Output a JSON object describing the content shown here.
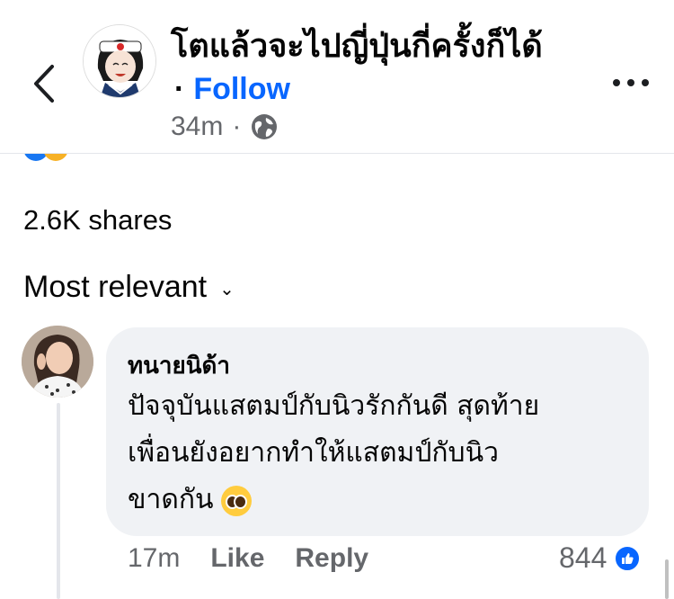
{
  "header": {
    "page_name": "โตแล้วจะไปญี่ปุ่นกี่ครั้งก็ได้",
    "follow_separator": "·",
    "follow_label": "Follow",
    "post_time": "34m",
    "meta_separator": "·",
    "privacy_icon": "globe-icon",
    "back_icon": "chevron-left-icon",
    "more_icon": "more-horizontal-icon"
  },
  "stats": {
    "shares": "2.6K shares"
  },
  "sort": {
    "label": "Most relevant",
    "chevron": "⌄"
  },
  "comment": {
    "author": "ทนายนิด้า",
    "text_lines": [
      "ปัจจุบันแสตมป์กับนิวรักกันดี สุดท้าย",
      "เพื่อนยังอยากทำให้แสตมป์กับนิว",
      "ขาดกัน"
    ],
    "emoji": "pleading-face-emoji",
    "time": "17m",
    "like_label": "Like",
    "reply_label": "Reply",
    "like_count": "844"
  },
  "colors": {
    "accent": "#0866ff",
    "secondary_text": "#65676b",
    "bubble_bg": "#f0f2f5"
  }
}
